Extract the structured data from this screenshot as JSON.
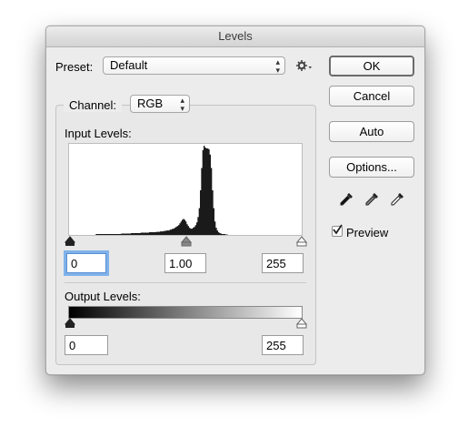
{
  "window": {
    "title": "Levels"
  },
  "preset": {
    "label": "Preset:",
    "value": "Default",
    "menu_icon": "gear-icon"
  },
  "channel": {
    "label": "Channel:",
    "value": "RGB"
  },
  "input_levels": {
    "label": "Input Levels:",
    "shadow": "0",
    "midtone": "1.00",
    "highlight": "255",
    "shadow_slider": 0,
    "midtone_slider": 0.5,
    "highlight_slider": 1.0
  },
  "output_levels": {
    "label": "Output Levels:",
    "shadow": "0",
    "highlight": "255",
    "shadow_slider": 0,
    "highlight_slider": 1.0
  },
  "buttons": {
    "ok": "OK",
    "cancel": "Cancel",
    "auto": "Auto",
    "options": "Options..."
  },
  "eyedroppers": [
    "black-point-eyedropper-icon",
    "gray-point-eyedropper-icon",
    "white-point-eyedropper-icon"
  ],
  "preview": {
    "label": "Preview",
    "checked": true
  },
  "histogram": {
    "bins": [
      0,
      0,
      0,
      0,
      0,
      0,
      0,
      0,
      0,
      0,
      0,
      0,
      0,
      0,
      0,
      0,
      0,
      0,
      0,
      0,
      0,
      0,
      0.01,
      0.01,
      0.01,
      0.01,
      0.01,
      0.01,
      0.01,
      0.01,
      0.01,
      0.01,
      0.01,
      0.01,
      0.01,
      0.01,
      0.01,
      0.01,
      0.01,
      0.01,
      0.01,
      0.01,
      0.01,
      0.015,
      0.015,
      0.015,
      0.015,
      0.015,
      0.015,
      0.015,
      0.015,
      0.02,
      0.02,
      0.02,
      0.02,
      0.02,
      0.02,
      0.02,
      0.02,
      0.025,
      0.025,
      0.025,
      0.025,
      0.025,
      0.025,
      0.025,
      0.03,
      0.03,
      0.03,
      0.03,
      0.03,
      0.03,
      0.035,
      0.035,
      0.035,
      0.04,
      0.04,
      0.04,
      0.045,
      0.045,
      0.05,
      0.05,
      0.05,
      0.06,
      0.06,
      0.07,
      0.07,
      0.08,
      0.09,
      0.1,
      0.11,
      0.13,
      0.15,
      0.17,
      0.18,
      0.17,
      0.15,
      0.12,
      0.1,
      0.08,
      0.07,
      0.07,
      0.08,
      0.09,
      0.11,
      0.14,
      0.2,
      0.3,
      0.5,
      0.75,
      0.95,
      1.0,
      0.98,
      0.97,
      0.97,
      0.96,
      0.9,
      0.75,
      0.5,
      0.3,
      0.15,
      0.08,
      0.05,
      0.03,
      0.02,
      0.015,
      0.01,
      0.01,
      0.01,
      0.005,
      0.005,
      0,
      0,
      0,
      0,
      0,
      0,
      0,
      0,
      0,
      0,
      0,
      0,
      0,
      0,
      0,
      0,
      0,
      0,
      0,
      0,
      0,
      0,
      0,
      0,
      0,
      0,
      0,
      0,
      0,
      0,
      0,
      0,
      0,
      0,
      0,
      0,
      0,
      0,
      0,
      0,
      0,
      0,
      0,
      0,
      0,
      0,
      0,
      0,
      0,
      0,
      0,
      0,
      0,
      0,
      0,
      0,
      0,
      0,
      0,
      0,
      0
    ]
  }
}
